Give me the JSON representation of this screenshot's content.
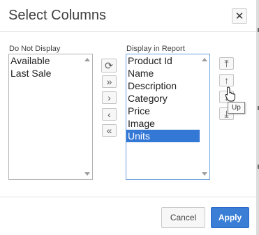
{
  "dialog": {
    "title": "Select Columns",
    "close_glyph": "✕"
  },
  "do_not_display": {
    "label": "Do Not Display",
    "items": [
      "Available",
      "Last Sale"
    ]
  },
  "display_in_report": {
    "label": "Display in Report",
    "items": [
      "Product Id",
      "Name",
      "Description",
      "Category",
      "Price",
      "Image",
      "Units"
    ],
    "selected": "Units"
  },
  "shuttle_controls": {
    "reset_glyph": "⟳",
    "move_all_glyph": "»",
    "move_glyph": "›",
    "remove_glyph": "‹",
    "remove_all_glyph": "«"
  },
  "order_controls": {
    "top_glyph": "⤒",
    "up_glyph": "↑",
    "down_glyph": "↓",
    "bottom_glyph": "⤓"
  },
  "tooltip": {
    "text": "Up"
  },
  "footer": {
    "cancel_label": "Cancel",
    "apply_label": "Apply"
  },
  "colors": {
    "accent": "#3a7fd5",
    "selection": "#3478d6"
  }
}
